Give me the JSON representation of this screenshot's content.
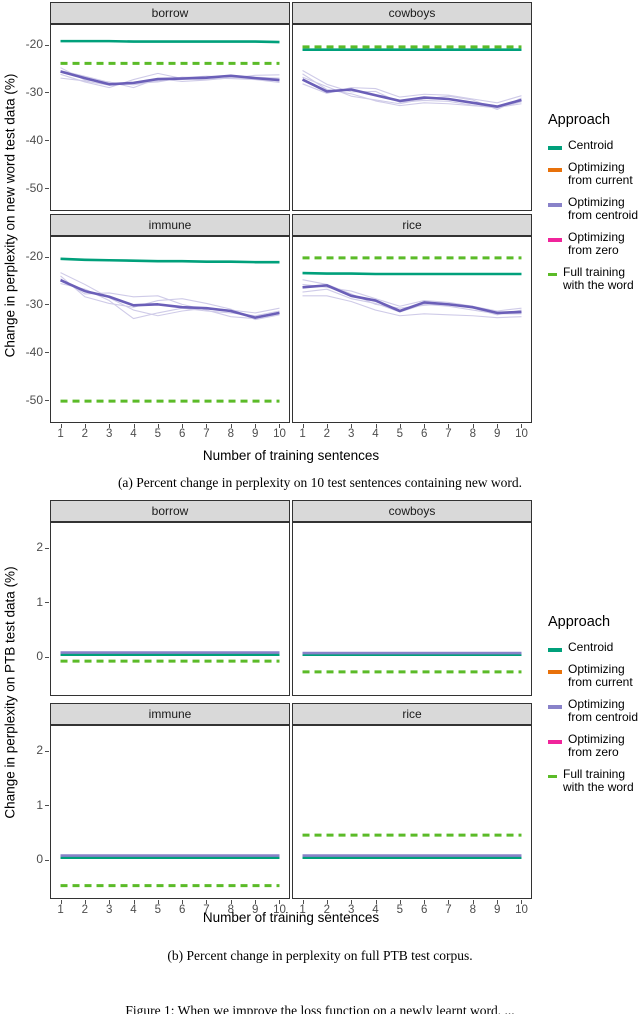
{
  "colors": {
    "centroid": "#00A07B",
    "opt_current": "#E8710A",
    "opt_centroid": "#6B5FB8",
    "opt_centroid_light": "#cfcbe8",
    "opt_zero": "#F0249B",
    "full_training": "#5BBB28",
    "strip_bg": "#d9d9d9",
    "border": "#333333",
    "tick_text": "#4d4d4d"
  },
  "legend": {
    "title": "Approach",
    "items": [
      {
        "label": "Centroid",
        "color": "#00A07B",
        "dashed": false,
        "key": "centroid"
      },
      {
        "label": "Optimizing\nfrom current",
        "color": "#E8710A",
        "dashed": false,
        "key": "opt_current"
      },
      {
        "label": "Optimizing\nfrom centroid",
        "color": "#8982C9",
        "dashed": false,
        "key": "opt_centroid"
      },
      {
        "label": "Optimizing\nfrom zero",
        "color": "#F0249B",
        "dashed": false,
        "key": "opt_zero"
      },
      {
        "label": "Full training\nwith the word",
        "color": "#5BBB28",
        "dashed": true,
        "key": "full_training"
      }
    ]
  },
  "figure_a": {
    "caption": "(a) Percent change in perplexity on 10 test sentences containing new word.",
    "ylabel": "Change in perplexity on new word test data (%)",
    "xlabel": "Number of training sentences",
    "yticks": [
      "-20",
      "-30",
      "-40",
      "-50"
    ],
    "xticks": [
      "1",
      "2",
      "3",
      "4",
      "5",
      "6",
      "7",
      "8",
      "9",
      "10"
    ],
    "panels": [
      "borrow",
      "cowboys",
      "immune",
      "rice"
    ]
  },
  "figure_b": {
    "caption": "(b) Percent change in perplexity on full PTB test corpus.",
    "ylabel": "Change in perplexity on PTB test data (%)",
    "xlabel": "Number of training sentences",
    "yticks": [
      "2",
      "1",
      "0"
    ],
    "xticks": [
      "1",
      "2",
      "3",
      "4",
      "5",
      "6",
      "7",
      "8",
      "9",
      "10"
    ],
    "panels": [
      "borrow",
      "cowboys",
      "immune",
      "rice"
    ]
  },
  "bottom_cut_text": "Figure 1: When we improve the loss function on a newly learnt word, ...",
  "chart_data": {
    "type": "line",
    "figures": [
      {
        "id": "a",
        "title": "(a) Percent change in perplexity on 10 test sentences containing new word.",
        "ylabel": "Change in perplexity on new word test data (%)",
        "xlabel": "Number of training sentences",
        "x": [
          1,
          2,
          3,
          4,
          5,
          6,
          7,
          8,
          9,
          10
        ],
        "ylim": [
          -55,
          -16
        ],
        "yticks": [
          -20,
          -30,
          -40,
          -50
        ],
        "grid": false,
        "legend_position": "right",
        "panels": [
          {
            "name": "borrow",
            "series": [
              {
                "name": "Centroid",
                "style": "solid",
                "color": "#00A07B",
                "values": [
                  -19.4,
                  -19.4,
                  -19.4,
                  -19.5,
                  -19.5,
                  -19.5,
                  -19.5,
                  -19.5,
                  -19.5,
                  -19.6
                ]
              },
              {
                "name": "Full training with the word",
                "style": "dashed",
                "color": "#5BBB28",
                "values": [
                  -24.1,
                  -24.1,
                  -24.1,
                  -24.1,
                  -24.1,
                  -24.1,
                  -24.1,
                  -24.1,
                  -24.1,
                  -24.1
                ]
              },
              {
                "name": "Optimizing from centroid",
                "style": "solid",
                "color": "#6B5FB8",
                "values": [
                  -25.8,
                  -27.2,
                  -28.5,
                  -28.2,
                  -27.4,
                  -27.3,
                  -27.1,
                  -26.7,
                  -27.2,
                  -27.6
                ]
              }
            ],
            "faint_runs": [
              [
                -25.0,
                -27.6,
                -28.0,
                -29.2,
                -27.3,
                -27.9,
                -27.6,
                -27.1,
                -27.0,
                -27.2
              ],
              [
                -27.2,
                -27.8,
                -28.7,
                -28.3,
                -28.0,
                -27.1,
                -26.8,
                -27.0,
                -27.4,
                -27.8
              ],
              [
                -26.4,
                -28.0,
                -29.2,
                -27.5,
                -26.2,
                -27.3,
                -27.5,
                -27.2,
                -26.6,
                -26.5
              ],
              [
                -25.6,
                -26.8,
                -28.1,
                -28.6,
                -27.8,
                -27.0,
                -27.2,
                -27.3,
                -27.5,
                -28.1
              ]
            ]
          },
          {
            "name": "cowboys",
            "series": [
              {
                "name": "Centroid",
                "style": "solid",
                "color": "#00A07B",
                "values": [
                  -21.2,
                  -21.2,
                  -21.2,
                  -21.2,
                  -21.2,
                  -21.2,
                  -21.2,
                  -21.2,
                  -21.2,
                  -21.2
                ]
              },
              {
                "name": "Full training with the word",
                "style": "dashed",
                "color": "#5BBB28",
                "values": [
                  -20.6,
                  -20.6,
                  -20.6,
                  -20.6,
                  -20.6,
                  -20.6,
                  -20.6,
                  -20.6,
                  -20.6,
                  -20.6
                ]
              },
              {
                "name": "Optimizing from centroid",
                "style": "solid",
                "color": "#6B5FB8",
                "values": [
                  -27.5,
                  -30.0,
                  -29.6,
                  -30.8,
                  -32.0,
                  -31.3,
                  -31.6,
                  -32.4,
                  -33.2,
                  -31.8
                ]
              }
            ],
            "faint_runs": [
              [
                -25.6,
                -28.5,
                -30.1,
                -30.0,
                -32.3,
                -31.9,
                -32.1,
                -32.9,
                -33.5,
                -32.2
              ],
              [
                -26.3,
                -29.6,
                -30.5,
                -32.0,
                -33.0,
                -32.4,
                -32.6,
                -33.0,
                -33.4,
                -32.6
              ],
              [
                -28.4,
                -30.4,
                -29.2,
                -29.4,
                -31.2,
                -30.6,
                -30.8,
                -31.6,
                -32.4,
                -30.9
              ],
              [
                -27.0,
                -29.0,
                -31.0,
                -31.8,
                -32.6,
                -31.6,
                -31.0,
                -31.8,
                -33.8,
                -31.4
              ]
            ]
          },
          {
            "name": "immune",
            "series": [
              {
                "name": "Centroid",
                "style": "solid",
                "color": "#00A07B",
                "values": [
                  -20.6,
                  -20.8,
                  -20.9,
                  -21.0,
                  -21.1,
                  -21.1,
                  -21.2,
                  -21.2,
                  -21.3,
                  -21.3
                ]
              },
              {
                "name": "Full training with the word",
                "style": "dashed",
                "color": "#5BBB28",
                "values": [
                  -50.6,
                  -50.6,
                  -50.6,
                  -50.6,
                  -50.6,
                  -50.6,
                  -50.6,
                  -50.6,
                  -50.6,
                  -50.6
                ]
              },
              {
                "name": "Optimizing from centroid",
                "style": "solid",
                "color": "#6B5FB8",
                "values": [
                  -25.1,
                  -27.4,
                  -28.6,
                  -30.4,
                  -30.2,
                  -30.8,
                  -31.0,
                  -31.6,
                  -33.0,
                  -32.0
                ]
              }
            ],
            "faint_runs": [
              [
                -23.5,
                -26.0,
                -28.8,
                -31.4,
                -32.6,
                -31.6,
                -31.0,
                -31.4,
                -32.0,
                -31.0
              ],
              [
                -24.2,
                -28.6,
                -30.0,
                -30.8,
                -29.4,
                -29.0,
                -30.0,
                -31.2,
                -33.4,
                -32.4
              ],
              [
                -25.8,
                -27.0,
                -29.4,
                -33.2,
                -32.0,
                -31.0,
                -31.6,
                -32.0,
                -32.6,
                -31.6
              ],
              [
                -24.8,
                -28.0,
                -27.8,
                -28.6,
                -28.4,
                -30.2,
                -31.4,
                -32.8,
                -33.2,
                -31.8
              ]
            ]
          },
          {
            "name": "rice",
            "series": [
              {
                "name": "Centroid",
                "style": "solid",
                "color": "#00A07B",
                "values": [
                  -23.6,
                  -23.7,
                  -23.7,
                  -23.8,
                  -23.8,
                  -23.8,
                  -23.8,
                  -23.8,
                  -23.8,
                  -23.8
                ]
              },
              {
                "name": "Full training with the word",
                "style": "dashed",
                "color": "#5BBB28",
                "values": [
                  -20.4,
                  -20.4,
                  -20.4,
                  -20.4,
                  -20.4,
                  -20.4,
                  -20.4,
                  -20.4,
                  -20.4,
                  -20.4
                ]
              },
              {
                "name": "Optimizing from centroid",
                "style": "solid",
                "color": "#6B5FB8",
                "values": [
                  -26.6,
                  -26.2,
                  -28.4,
                  -29.4,
                  -31.6,
                  -29.8,
                  -30.2,
                  -30.8,
                  -32.0,
                  -31.8
                ]
              }
            ],
            "faint_runs": [
              [
                -25.0,
                -26.0,
                -28.0,
                -30.2,
                -31.0,
                -30.4,
                -30.0,
                -31.0,
                -32.4,
                -31.4
              ],
              [
                -27.6,
                -27.0,
                -29.0,
                -30.0,
                -31.8,
                -30.2,
                -30.6,
                -31.4,
                -32.2,
                -32.2
              ],
              [
                -28.4,
                -28.4,
                -29.6,
                -31.4,
                -32.6,
                -32.2,
                -32.4,
                -32.6,
                -33.0,
                -32.8
              ],
              [
                -26.0,
                -26.6,
                -27.4,
                -29.0,
                -30.6,
                -29.4,
                -29.8,
                -30.6,
                -31.6,
                -31.0
              ]
            ]
          }
        ]
      },
      {
        "id": "b",
        "title": "(b) Percent change in perplexity on full PTB test corpus.",
        "ylabel": "Change in perplexity on PTB test data (%)",
        "xlabel": "Number of training sentences",
        "x": [
          1,
          2,
          3,
          4,
          5,
          6,
          7,
          8,
          9,
          10
        ],
        "ylim": [
          -0.75,
          2.45
        ],
        "yticks": [
          2,
          1,
          0
        ],
        "grid": false,
        "legend_position": "right",
        "panels": [
          {
            "name": "borrow",
            "series": [
              {
                "name": "Centroid",
                "style": "solid",
                "color": "#00A07B",
                "values": [
                  0.0,
                  0.0,
                  0.0,
                  0.0,
                  0.0,
                  0.0,
                  0.0,
                  0.0,
                  0.0,
                  0.0
                ]
              },
              {
                "name": "Optimizing from centroid",
                "style": "solid",
                "color": "#8982C9",
                "values": [
                  0.04,
                  0.04,
                  0.04,
                  0.04,
                  0.04,
                  0.04,
                  0.04,
                  0.04,
                  0.04,
                  0.04
                ]
              },
              {
                "name": "Full training with the word",
                "style": "dashed",
                "color": "#5BBB28",
                "values": [
                  -0.12,
                  -0.12,
                  -0.12,
                  -0.12,
                  -0.12,
                  -0.12,
                  -0.12,
                  -0.12,
                  -0.12,
                  -0.12
                ]
              }
            ],
            "faint_runs": []
          },
          {
            "name": "cowboys",
            "series": [
              {
                "name": "Centroid",
                "style": "solid",
                "color": "#00A07B",
                "values": [
                  0.0,
                  0.0,
                  0.0,
                  0.0,
                  0.0,
                  0.0,
                  0.0,
                  0.0,
                  0.0,
                  0.0
                ]
              },
              {
                "name": "Optimizing from centroid",
                "style": "solid",
                "color": "#8982C9",
                "values": [
                  0.03,
                  0.03,
                  0.03,
                  0.03,
                  0.03,
                  0.03,
                  0.03,
                  0.03,
                  0.03,
                  0.03
                ]
              },
              {
                "name": "Full training with the word",
                "style": "dashed",
                "color": "#5BBB28",
                "values": [
                  -0.32,
                  -0.32,
                  -0.32,
                  -0.32,
                  -0.32,
                  -0.32,
                  -0.32,
                  -0.32,
                  -0.32,
                  -0.32
                ]
              }
            ],
            "faint_runs": []
          },
          {
            "name": "immune",
            "series": [
              {
                "name": "Centroid",
                "style": "solid",
                "color": "#00A07B",
                "values": [
                  0.0,
                  0.0,
                  0.0,
                  0.0,
                  0.0,
                  0.0,
                  0.0,
                  0.0,
                  0.0,
                  0.0
                ]
              },
              {
                "name": "Optimizing from centroid",
                "style": "solid",
                "color": "#8982C9",
                "values": [
                  0.04,
                  0.04,
                  0.04,
                  0.04,
                  0.04,
                  0.04,
                  0.04,
                  0.04,
                  0.04,
                  0.04
                ]
              },
              {
                "name": "Full training with the word",
                "style": "dashed",
                "color": "#5BBB28",
                "values": [
                  -0.52,
                  -0.52,
                  -0.52,
                  -0.52,
                  -0.52,
                  -0.52,
                  -0.52,
                  -0.52,
                  -0.52,
                  -0.52
                ]
              }
            ],
            "faint_runs": []
          },
          {
            "name": "rice",
            "series": [
              {
                "name": "Centroid",
                "style": "solid",
                "color": "#00A07B",
                "values": [
                  0.0,
                  0.0,
                  0.0,
                  0.0,
                  0.0,
                  0.0,
                  0.0,
                  0.0,
                  0.0,
                  0.0
                ]
              },
              {
                "name": "Optimizing from centroid",
                "style": "solid",
                "color": "#8982C9",
                "values": [
                  0.04,
                  0.04,
                  0.04,
                  0.04,
                  0.04,
                  0.04,
                  0.04,
                  0.04,
                  0.04,
                  0.04
                ]
              },
              {
                "name": "Full training with the word",
                "style": "dashed",
                "color": "#5BBB28",
                "values": [
                  0.42,
                  0.42,
                  0.42,
                  0.42,
                  0.42,
                  0.42,
                  0.42,
                  0.42,
                  0.42,
                  0.42
                ]
              }
            ],
            "faint_runs": []
          }
        ]
      }
    ]
  }
}
